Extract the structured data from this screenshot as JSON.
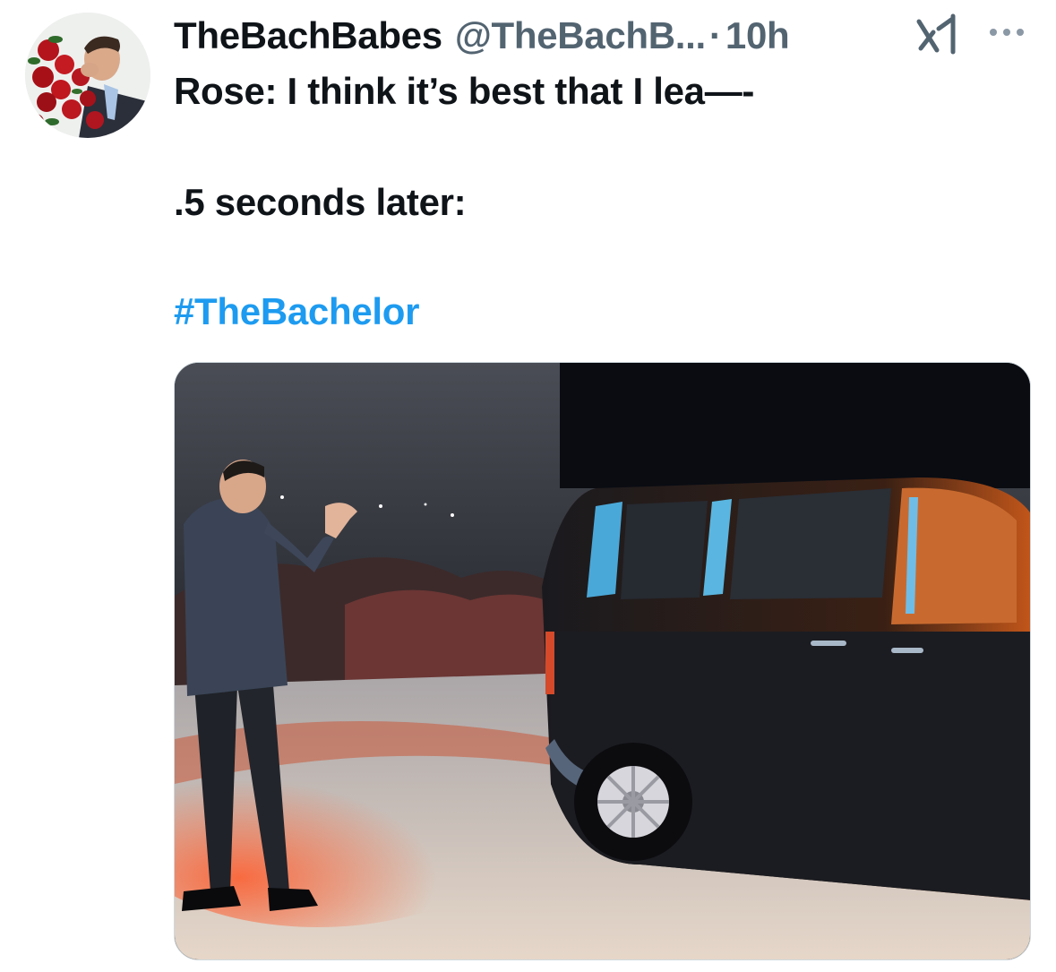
{
  "tweet": {
    "author": {
      "display_name": "TheBachBabes",
      "handle": "@TheBachB...",
      "avatar_icon": "profile-photo-man-with-roses"
    },
    "separator": "·",
    "timestamp": "10h",
    "text_line_1": "Rose: I think it’s best that I lea—-",
    "text_line_2": ".5 seconds later:",
    "hashtag": "#TheBachelor",
    "icons": {
      "grok": "grok-icon",
      "more": "more-options-icon"
    },
    "media": {
      "type": "photo",
      "icon": "photo-of-tv-screen-man-waving-at-suv-at-night"
    },
    "colors": {
      "text": "#0f1419",
      "secondary": "#536471",
      "link": "#1d9bf0",
      "background": "#ffffff"
    }
  }
}
